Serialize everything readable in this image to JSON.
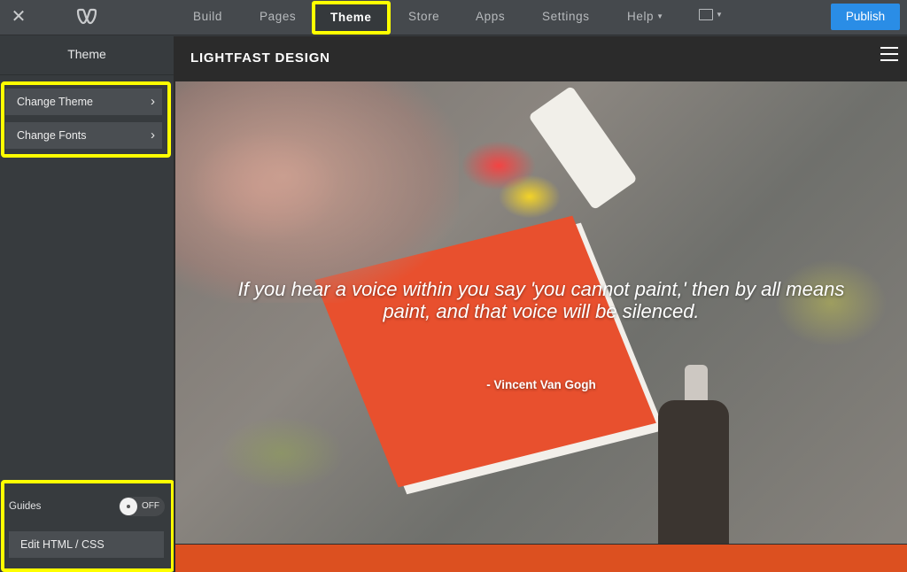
{
  "topbar": {
    "close_icon": "close-icon",
    "logo_icon": "weebly-logo-icon",
    "nav": [
      {
        "label": "Build",
        "active": false
      },
      {
        "label": "Pages",
        "active": false
      },
      {
        "label": "Theme",
        "active": true
      },
      {
        "label": "Store",
        "active": false
      },
      {
        "label": "Apps",
        "active": false
      },
      {
        "label": "Settings",
        "active": false
      },
      {
        "label": "Help",
        "active": false,
        "has_dropdown": true
      }
    ],
    "device_icon": "desktop-device-icon",
    "publish_label": "Publish",
    "colors": {
      "publish": "#2a8de6",
      "highlight": "#ffff00"
    }
  },
  "sidebar": {
    "title": "Theme",
    "items": [
      {
        "label": "Change Theme",
        "icon": "chevron-right-icon"
      },
      {
        "label": "Change Fonts",
        "icon": "chevron-right-icon"
      }
    ],
    "guides": {
      "label": "Guides",
      "state": "OFF"
    },
    "edit_label": "Edit HTML / CSS"
  },
  "preview": {
    "site_title": "LIGHTFAST DESIGN",
    "menu_icon": "hamburger-menu-icon",
    "quote_line1": "If you hear a voice within you say 'you cannot paint,' then by all means",
    "quote_line2": "paint, and that voice will be silenced.",
    "author": "- Vincent Van Gogh",
    "band_color": "#dc5020"
  }
}
